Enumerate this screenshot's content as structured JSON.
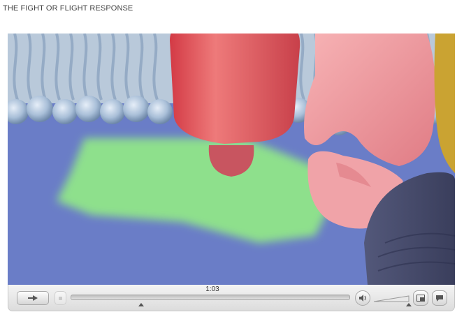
{
  "page": {
    "title": "THE FIGHT OR FLIGHT RESPONSE"
  },
  "player": {
    "video": {
      "subject": "cell-membrane-animation-frame"
    },
    "controls": {
      "current_time": "1:03",
      "progress_fraction": 0.0,
      "volume_fraction": 0.95,
      "icons": {
        "play": "play-icon",
        "stop": "stop-icon",
        "volume": "speaker-icon",
        "pip": "picture-in-picture-icon",
        "captions": "speech-bubble-icon"
      }
    }
  }
}
